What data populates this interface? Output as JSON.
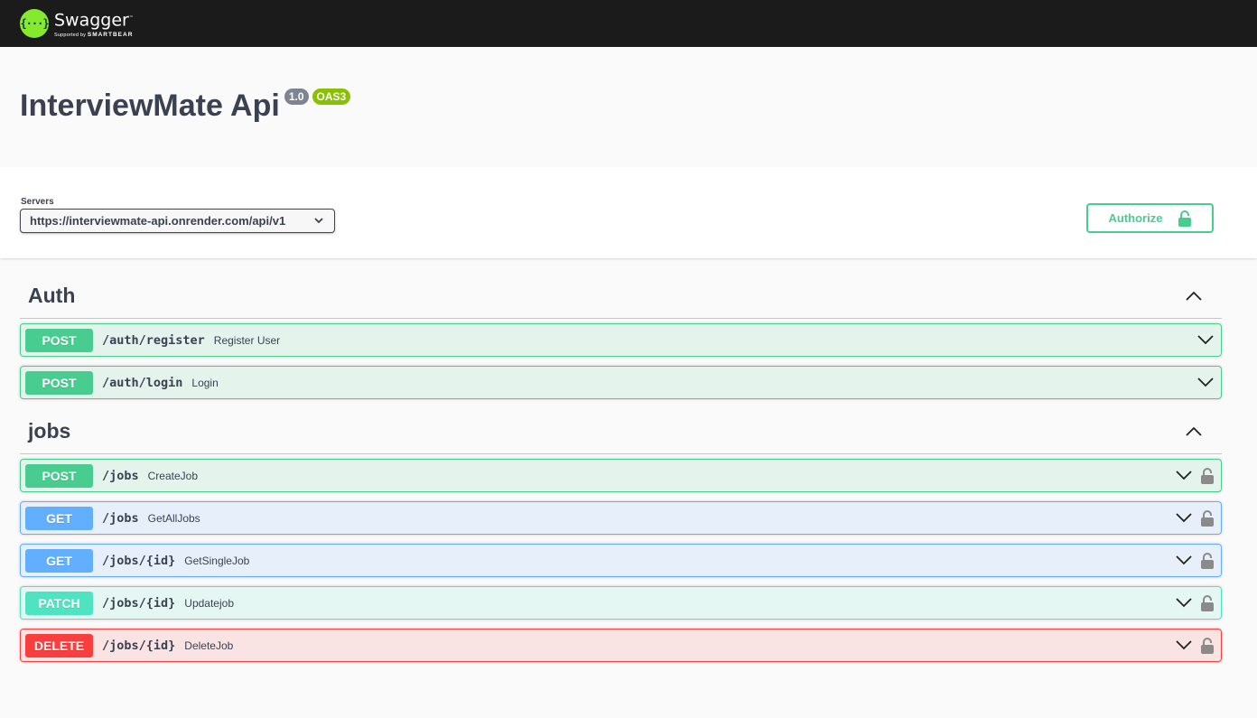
{
  "topbar": {
    "logo_glyph": "{···}",
    "brand": "Swagger",
    "supported_by": "Supported by",
    "company": "SMARTBEAR"
  },
  "info": {
    "title": "InterviewMate Api",
    "version_badge": "1.0",
    "oas_badge": "OAS3"
  },
  "scheme": {
    "servers_label": "Servers",
    "selected_server": "https://interviewmate-api.onrender.com/api/v1",
    "authorize_label": "Authorize"
  },
  "tags": [
    {
      "name": "Auth",
      "operations": [
        {
          "method": "POST",
          "path": "/auth/register",
          "summary": "Register User",
          "locked": false
        },
        {
          "method": "POST",
          "path": "/auth/login",
          "summary": "Login",
          "locked": false
        }
      ]
    },
    {
      "name": "jobs",
      "operations": [
        {
          "method": "POST",
          "path": "/jobs",
          "summary": "CreateJob",
          "locked": true
        },
        {
          "method": "GET",
          "path": "/jobs",
          "summary": "GetAllJobs",
          "locked": true
        },
        {
          "method": "GET",
          "path": "/jobs/{id}",
          "summary": "GetSingleJob",
          "locked": true
        },
        {
          "method": "PATCH",
          "path": "/jobs/{id}",
          "summary": "Updatejob",
          "locked": true
        },
        {
          "method": "DELETE",
          "path": "/jobs/{id}",
          "summary": "DeleteJob",
          "locked": true
        }
      ]
    }
  ],
  "colors": {
    "post": "#49cc90",
    "get": "#61affe",
    "patch": "#50e3c2",
    "delete": "#f93e3e",
    "brand_green": "#85ea2d",
    "topbar": "#1b1b1b"
  }
}
